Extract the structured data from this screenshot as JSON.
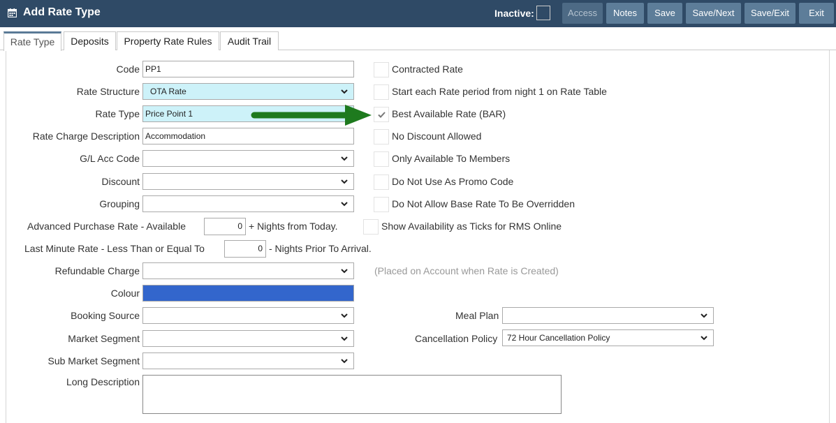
{
  "window": {
    "title": "Add Rate Type"
  },
  "header": {
    "inactive_label": "Inactive:",
    "buttons": {
      "access": "Access",
      "notes": "Notes",
      "save": "Save",
      "save_next": "Save/Next",
      "save_exit": "Save/Exit",
      "exit": "Exit"
    }
  },
  "tabs": [
    {
      "label": "Rate Type",
      "active": true
    },
    {
      "label": "Deposits"
    },
    {
      "label": "Property Rate Rules"
    },
    {
      "label": "Audit Trail"
    }
  ],
  "form": {
    "code": {
      "label": "Code",
      "value": "PP1"
    },
    "rate_structure": {
      "label": "Rate Structure",
      "value": "OTA Rate"
    },
    "rate_type": {
      "label": "Rate Type",
      "value": "Price Point 1"
    },
    "rate_charge_description": {
      "label": "Rate Charge Description",
      "value": "Accommodation"
    },
    "gl_acc_code": {
      "label": "G/L Acc Code",
      "value": ""
    },
    "discount": {
      "label": "Discount",
      "value": ""
    },
    "grouping": {
      "label": "Grouping",
      "value": ""
    },
    "advanced_purchase": {
      "label": "Advanced Purchase Rate - Available",
      "value": "0",
      "suffix": "+ Nights from Today."
    },
    "last_minute": {
      "label": "Last Minute Rate - Less Than or Equal To",
      "value": "0",
      "suffix": "- Nights Prior To Arrival."
    },
    "refundable_charge": {
      "label": "Refundable Charge",
      "value": "",
      "hint": "(Placed on Account when Rate is Created)"
    },
    "colour": {
      "label": "Colour",
      "value": "#3366cc"
    },
    "booking_source": {
      "label": "Booking Source",
      "value": ""
    },
    "market_segment": {
      "label": "Market Segment",
      "value": ""
    },
    "sub_market_segment": {
      "label": "Sub Market Segment",
      "value": ""
    },
    "long_description": {
      "label": "Long Description",
      "value": ""
    },
    "meal_plan": {
      "label": "Meal Plan",
      "value": ""
    },
    "cancellation_policy": {
      "label": "Cancellation Policy",
      "value": "72 Hour Cancellation Policy"
    }
  },
  "checkboxes": {
    "contracted_rate": {
      "label": "Contracted Rate",
      "checked": false
    },
    "start_each_rate": {
      "label": "Start each Rate period from night 1 on Rate Table",
      "checked": false
    },
    "bar": {
      "label": "Best Available Rate (BAR)",
      "checked": true
    },
    "no_discount": {
      "label": "No Discount Allowed",
      "checked": false
    },
    "members_only": {
      "label": "Only Available To Members",
      "checked": false
    },
    "no_promo": {
      "label": "Do Not Use As Promo Code",
      "checked": false
    },
    "no_override": {
      "label": "Do Not Allow Base Rate To Be Overridden",
      "checked": false
    },
    "show_ticks": {
      "label": "Show Availability as Ticks for RMS Online",
      "checked": false
    }
  },
  "colors": {
    "header": "#2f4a66",
    "button": "#5d7d99",
    "highlight": "#cdf2f9",
    "arrow": "#1e7a1e"
  },
  "icons": {
    "title": "calendar-icon",
    "arrow": "arrow-right-icon",
    "check": "checkmark-icon",
    "select": "chevron-down-icon"
  }
}
